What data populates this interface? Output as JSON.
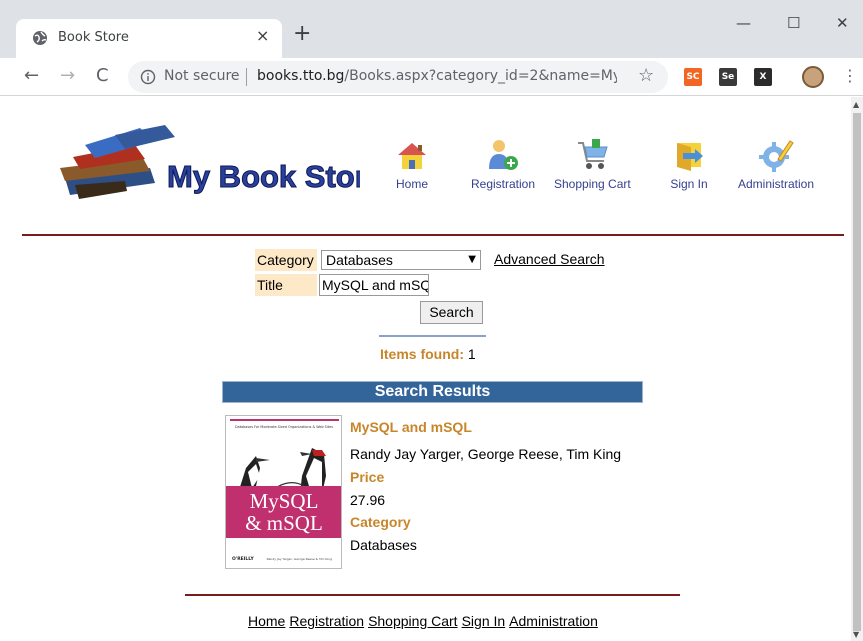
{
  "browser": {
    "tab_title": "Book Store",
    "tab_close": "×",
    "new_tab": "+",
    "minimize": "—",
    "maximize": "☐",
    "close": "✕",
    "back": "←",
    "forward": "→",
    "reload": "C",
    "not_secure": "Not secure",
    "url_host": "books.tto.bg",
    "url_path": "/Books.aspx?category_id=2&name=My...",
    "star": "☆",
    "menu": "⋮",
    "extensions": [
      {
        "label": "SC",
        "color": "#f26522"
      },
      {
        "label": "Se",
        "color": "#3a3a3a"
      },
      {
        "label": "X",
        "color": "#2b2b2b"
      }
    ]
  },
  "header": {
    "logo_text": "My Book Store",
    "nav": [
      {
        "label": "Home",
        "icon": "home-icon"
      },
      {
        "label": "Registration",
        "icon": "registration-icon"
      },
      {
        "label": "Shopping Cart",
        "icon": "shopping-cart-icon"
      },
      {
        "label": "Sign In",
        "icon": "sign-in-icon"
      },
      {
        "label": "Administration",
        "icon": "administration-icon"
      }
    ]
  },
  "search": {
    "category_label": "Category",
    "category_value": "Databases",
    "title_label": "Title",
    "title_value": "MySQL and mSQL",
    "button": "Search",
    "advanced": "Advanced Search"
  },
  "results": {
    "items_found_label": "Items found:",
    "items_found_count": "1",
    "header": "Search Results",
    "books": [
      {
        "title": "MySQL and mSQL",
        "authors": "Randy Jay Yarger, George Reese, Tim King",
        "price_label": "Price",
        "price": "27.96",
        "category_label": "Category",
        "category": "Databases",
        "cover_text_line1": "MySQL",
        "cover_text_line2": "& mSQL",
        "cover_publisher": "O'REILLY",
        "cover_tagline": "Databases For Moderate-Sized Organizations & Web Sites",
        "cover_authors": "Randy Jay Yarger, George Reese & Tim King"
      }
    ]
  },
  "footer": {
    "links": [
      "Home",
      "Registration",
      "Shopping Cart",
      "Sign In",
      "Administration"
    ]
  }
}
